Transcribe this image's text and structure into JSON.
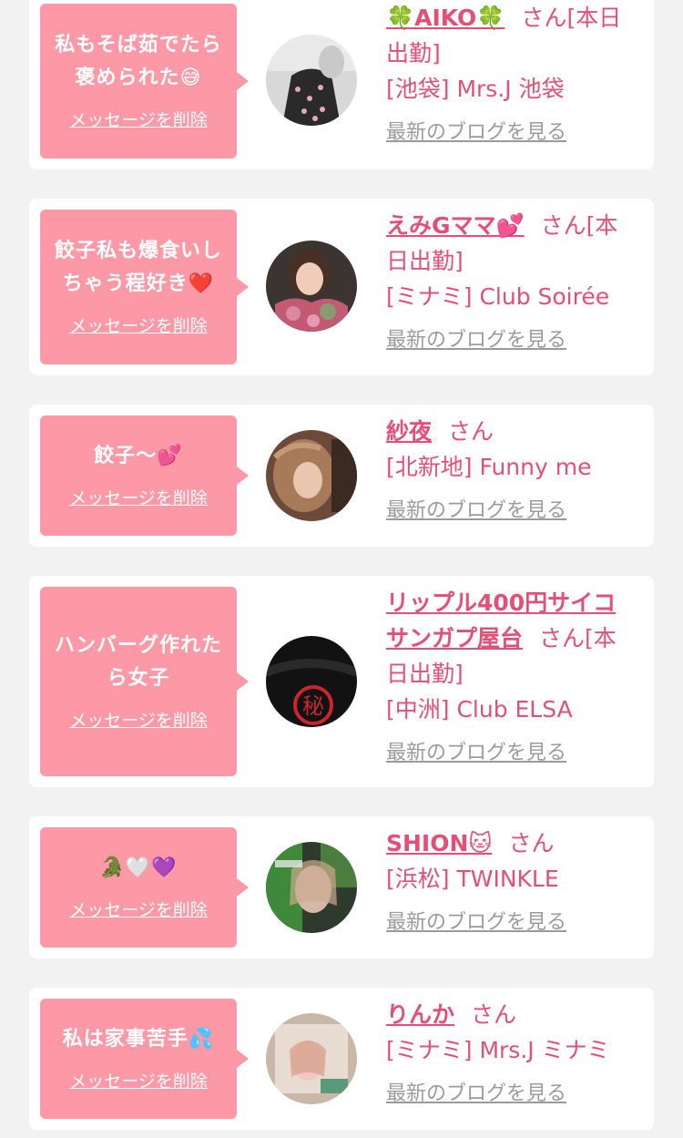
{
  "cards": [
    {
      "message": "私もそば茹でたら褒められた😅",
      "delete_label": "メッセージを削除",
      "name": "🍀AIKO🍀",
      "honorific": "さん",
      "status": "[本日出勤]",
      "shop": "[池袋] Mrs.J 池袋",
      "blog_label": "最新のブログを見る"
    },
    {
      "message": "餃子私も爆食いしちゃう程好き❤️",
      "delete_label": "メッセージを削除",
      "name": "えみGママ💕",
      "honorific": "さん",
      "status": "[本日出勤]",
      "shop": "[ミナミ] Club Soirée",
      "blog_label": "最新のブログを見る"
    },
    {
      "message": "餃子〜💕",
      "delete_label": "メッセージを削除",
      "name": "紗夜",
      "honorific": "さん",
      "status": "",
      "shop": "[北新地] Funny me",
      "blog_label": "最新のブログを見る"
    },
    {
      "message": "ハンバーグ作れたら女子",
      "delete_label": "メッセージを削除",
      "name": "リップル400円サイコサンガプ屋台",
      "honorific": "さん",
      "status": "[本日出勤]",
      "shop": "[中洲] Club ELSA",
      "blog_label": "最新のブログを見る"
    },
    {
      "message": "🐊🤍💜",
      "delete_label": "メッセージを削除",
      "name": "SHION🐱",
      "honorific": "さん",
      "status": "",
      "shop": "[浜松] TWINKLE",
      "blog_label": "最新のブログを見る"
    },
    {
      "message": "私は家事苦手💦",
      "delete_label": "メッセージを削除",
      "name": "りんか",
      "honorific": "さん",
      "status": "",
      "shop": "[ミナミ] Mrs.J ミナミ",
      "blog_label": "最新のブログを見る"
    }
  ]
}
